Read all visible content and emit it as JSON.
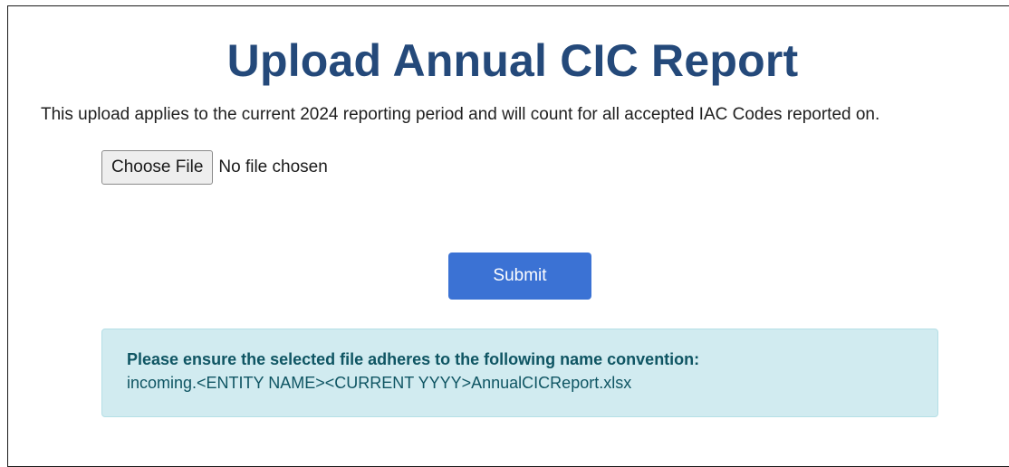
{
  "page": {
    "title": "Upload Annual CIC Report",
    "description": "This upload applies to the current 2024 reporting period and will count for all accepted IAC Codes reported on."
  },
  "file_input": {
    "button_label": "Choose File",
    "status_text": "No file chosen"
  },
  "submit": {
    "label": "Submit"
  },
  "notice": {
    "heading": "Please ensure the selected file adheres to the following name convention:",
    "body": "incoming.<ENTITY NAME><CURRENT YYYY>AnnualCICReport.xlsx"
  },
  "colors": {
    "title": "#24497a",
    "submit_bg": "#3b72d4",
    "alert_bg": "#d1ebf0",
    "alert_text": "#0f5563"
  }
}
